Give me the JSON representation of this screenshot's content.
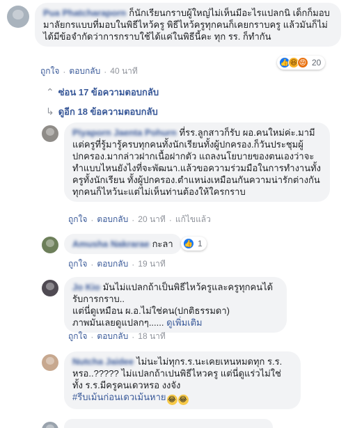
{
  "comments": [
    {
      "id": "c1",
      "name": "Pua Phatcharaporn",
      "text": "ก็นักเรียนกราบผู้ใหญ่ไม่เห็นมีอะไรแปลกนิ เด็กก็มอบมาลัยกรแบบที่มอบในพิธีไหว้ครู พิธีไหว้ครูทุกคนก็เคยกราบครู แล้วมันก็ไม่ได้มีข้อจำกัดว่าการกราบใช้ได้แค่ในพิธีนี้คะ ทุก รร. ก็ทำกัน",
      "like": "ถูกใจ",
      "reply": "ตอบกลับ",
      "time": "40 นาที",
      "reaction_count": "20"
    },
    {
      "id": "c2",
      "name": "Piyaporn Jaenta Pohurn",
      "text": "ที่รร.ลูกสาวก็รับ ผอ.คนใหม่ค่ะ.มามีแต่ครูที่รู้มารู้ครบทุกคนทั้งนักเรียนทั้งผู้ปกครอง.ก็วันประชุมผู้ปกครอง.มากล่าวฝากเนื้อฝากตัว แถลงนโยบายของตนเองว่าจะทำแบบไหนยังไงที่จะพัฒนา.แล้วขอความร่วมมือในการทำงานทั้งครูทั้งนักเรียน ทั้งผู้ปกครอง.ตำแหน่งเหมือนกันความน่ารักต่างกันทุกคนก็ไหว้นะแต่ไม่เห็นท่านต้องให้ใครกราบ",
      "like": "ถูกใจ",
      "reply": "ตอบกลับ",
      "time": "20 นาที",
      "edited": "แก้ไขแล้ว"
    },
    {
      "id": "c3",
      "name": "Amusha Nakrarae",
      "text": "กะลา",
      "reaction_count": "1",
      "like": "ถูกใจ",
      "reply": "ตอบกลับ",
      "time": "19 นาที"
    },
    {
      "id": "c4",
      "name": "Jo Kio",
      "text_lines": [
        "มันไม่แปลกถ้าเป็นพิธีไหว้ครูและครูทุกคนได้รับการกราบ..",
        "แต่นี่ดูเหมือน ผ.อ.ไม่ใช่คน(ปกติธรรมดา)",
        "ภาพมันเลยดูแปลกๆ......"
      ],
      "see_more": "ดูเพิ่มเติม",
      "like": "ถูกใจ",
      "reply": "ตอบกลับ",
      "time": "18 นาที"
    },
    {
      "id": "c5",
      "name": "Nutcha Jaidee",
      "text": "ไม่นะไม่ทุกร.ร.นะเคยเหนหมดทุก ร.ร. หรอ..????? ไม่แปลกถ้าเปนพิธีไหวครู แต่นี่ดูแร่วไม่ใช่ ทั้ง ร.ร.มีครูคนเดวหรอ งงจัง",
      "hashtag": "#รีบเม้นก่อนเดวเม้นหาย"
    }
  ],
  "toggles": {
    "hide_replies": "ซ่อน 17 ข้อความตอบกลับ",
    "view_replies": "ดูอีก 18 ข้อความตอบกลับ"
  },
  "colors": {
    "link": "#385898",
    "bubble": "#f2f3f5",
    "meta": "#90949c"
  }
}
